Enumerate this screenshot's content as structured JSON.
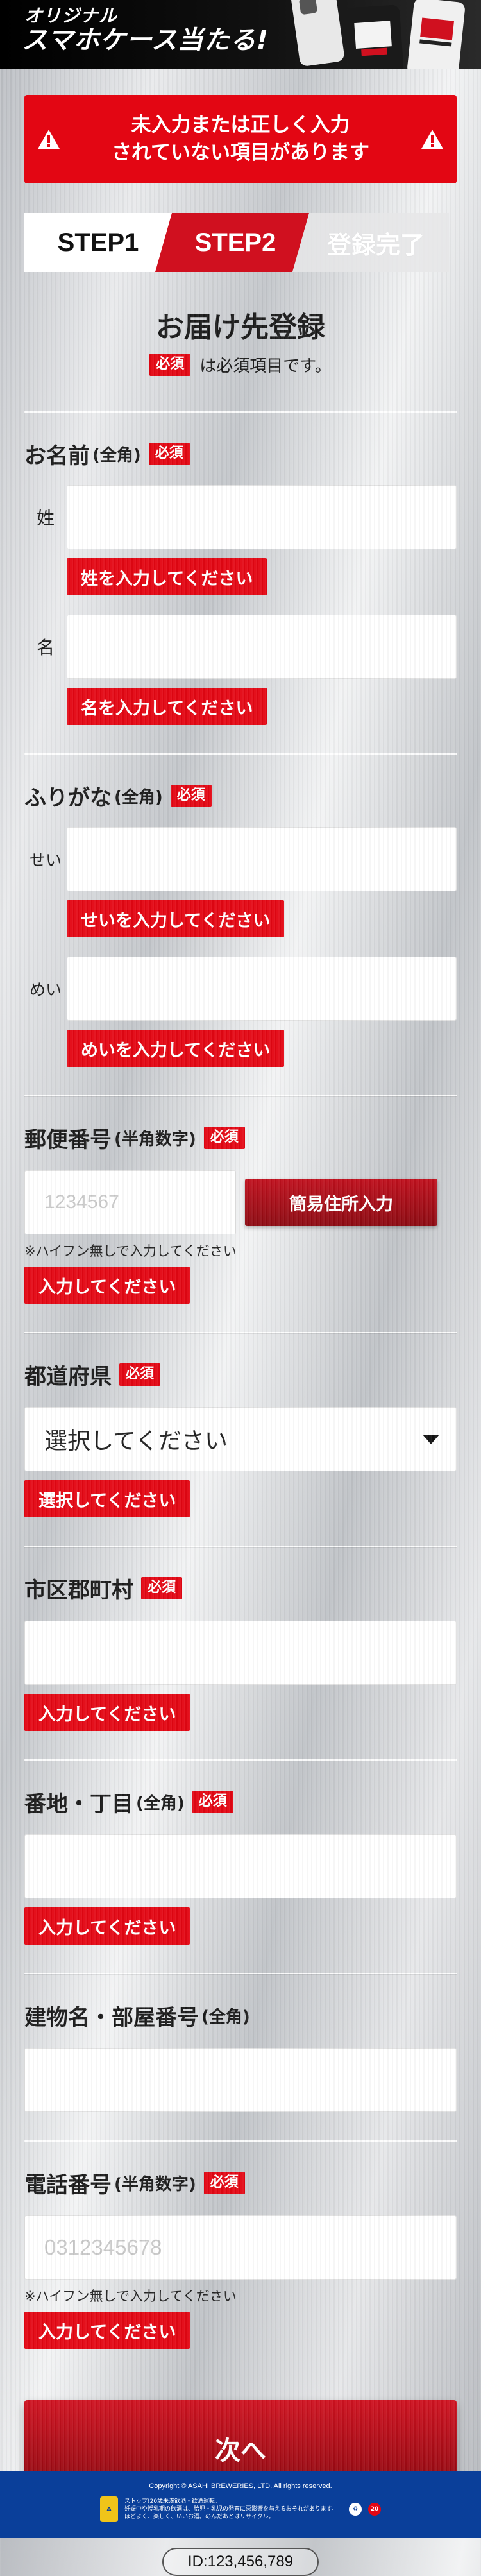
{
  "header": {
    "title_line1": "オリジナル",
    "title_line2": "スマホケース当たる!"
  },
  "alert": {
    "message_line1": "未入力または正しく入力",
    "message_line2": "されていない項目があります"
  },
  "steps": [
    "STEP1",
    "STEP2",
    "登録完了"
  ],
  "form": {
    "title": "お届け先登録",
    "required_badge": "必須",
    "required_note": "は必須項目です。"
  },
  "fields": {
    "name": {
      "label": "お名前",
      "hint": "(全角)",
      "sub1": "姓",
      "err1": "姓を入力してください",
      "sub2": "名",
      "err2": "名を入力してください"
    },
    "kana": {
      "label": "ふりがな",
      "hint": "(全角)",
      "sub1": "せい",
      "err1": "せいを入力してください",
      "sub2": "めい",
      "err2": "めいを入力してください"
    },
    "zip": {
      "label": "郵便番号",
      "hint": "(半角数字)",
      "placeholder": "1234567",
      "button": "簡易住所入力",
      "help": "※ハイフン無しで入力してください",
      "err": "入力してください"
    },
    "pref": {
      "label": "都道府県",
      "selected": "選択してください",
      "err": "選択してください"
    },
    "city": {
      "label": "市区郡町村",
      "err": "入力してください"
    },
    "street": {
      "label": "番地・丁目",
      "hint": "(全角)",
      "err": "入力してください"
    },
    "building": {
      "label": "建物名・部屋番号",
      "hint": "(全角)"
    },
    "tel": {
      "label": "電話番号",
      "hint": "(半角数字)",
      "placeholder": "0312345678",
      "help": "※ハイフン無しで入力してください",
      "err": "入力してください"
    }
  },
  "next_button": "次へ",
  "id_text": "ID:123,456,789",
  "footer": {
    "copyright": "Copyright © ASAHI BREWERIES, LTD. All rights reserved.",
    "note1": "ストップ!20歳未満飲酒・飲酒運転。",
    "note2": "妊娠中や授乳期の飲酒は、胎児・乳児の発育に悪影響を与えるおそれがあります。",
    "note3": "ほどよく、楽しく、いいお酒。のんだあとはリサイクル。"
  }
}
